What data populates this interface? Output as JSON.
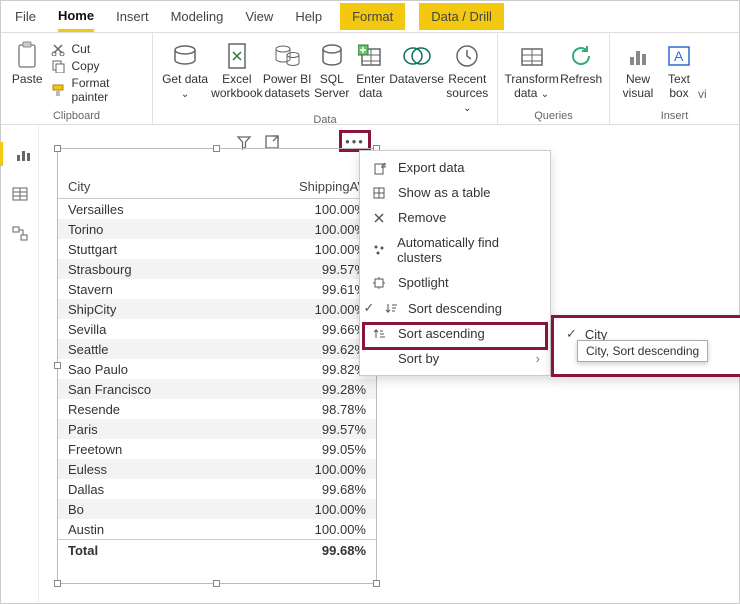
{
  "tabs": {
    "file": "File",
    "home": "Home",
    "insert": "Insert",
    "modeling": "Modeling",
    "view": "View",
    "help": "Help",
    "format": "Format",
    "datadrill": "Data / Drill"
  },
  "ribbon": {
    "clipboard": {
      "label": "Clipboard",
      "paste": "Paste",
      "cut": "Cut",
      "copy": "Copy",
      "format_painter": "Format painter"
    },
    "data": {
      "label": "Data",
      "get_data": "Get data",
      "excel": "Excel workbook",
      "pbi": "Power BI datasets",
      "sql": "SQL Server",
      "enter": "Enter data",
      "dataverse": "Dataverse",
      "recent": "Recent sources"
    },
    "queries": {
      "label": "Queries",
      "transform": "Transform data",
      "refresh": "Refresh"
    },
    "insert": {
      "label": "Insert",
      "new_visual": "New visual",
      "text_box": "Text box",
      "vi": "vi"
    }
  },
  "table": {
    "col1": "City",
    "col2": "ShippingAV",
    "rows": [
      {
        "c": "Versailles",
        "v": "100.00%"
      },
      {
        "c": "Torino",
        "v": "100.00%"
      },
      {
        "c": "Stuttgart",
        "v": "100.00%"
      },
      {
        "c": "Strasbourg",
        "v": "99.57%"
      },
      {
        "c": "Stavern",
        "v": "99.61%"
      },
      {
        "c": "ShipCity",
        "v": "100.00%"
      },
      {
        "c": "Sevilla",
        "v": "99.66%"
      },
      {
        "c": "Seattle",
        "v": "99.62%"
      },
      {
        "c": "Sao Paulo",
        "v": "99.82%"
      },
      {
        "c": "San Francisco",
        "v": "99.28%"
      },
      {
        "c": "Resende",
        "v": "98.78%"
      },
      {
        "c": "Paris",
        "v": "99.57%"
      },
      {
        "c": "Freetown",
        "v": "99.05%"
      },
      {
        "c": "Euless",
        "v": "100.00%"
      },
      {
        "c": "Dallas",
        "v": "99.68%"
      },
      {
        "c": "Bo",
        "v": "100.00%"
      },
      {
        "c": "Austin",
        "v": "100.00%"
      }
    ],
    "total_label": "Total",
    "total_value": "99.68%"
  },
  "ctx": {
    "export": "Export data",
    "show_table": "Show as a table",
    "remove": "Remove",
    "clusters": "Automatically find clusters",
    "spotlight": "Spotlight",
    "sort_desc": "Sort descending",
    "sort_asc": "Sort ascending",
    "sort_by": "Sort by"
  },
  "submenu": {
    "city": "City"
  },
  "tooltip": "City, Sort descending"
}
